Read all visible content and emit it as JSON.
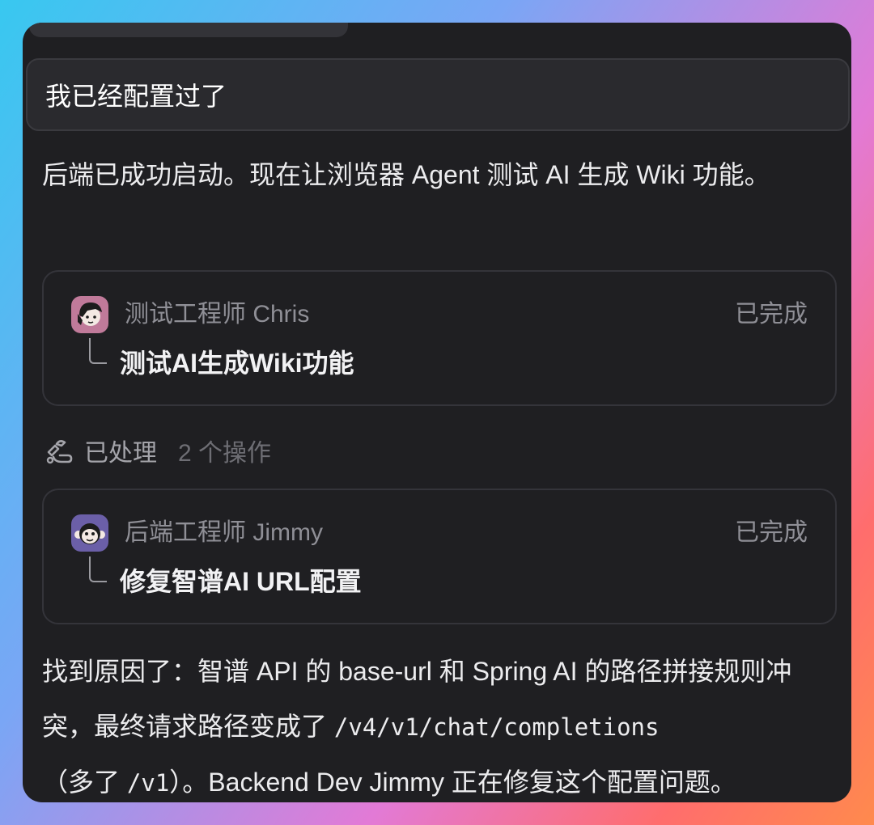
{
  "user_message": "我已经配置过了",
  "assistant_intro": "后端已成功启动。现在让浏览器 Agent 测试 AI 生成 Wiki 功能。",
  "tasks": [
    {
      "agent": "测试工程师 Chris",
      "status": "已完成",
      "task": "测试AI生成Wiki功能",
      "avatar_icon": "girl-avatar-icon",
      "avatar_color": "#c07a9a"
    },
    {
      "agent": "后端工程师 Jimmy",
      "status": "已完成",
      "task": "修复智谱AI URL配置",
      "avatar_icon": "monkey-avatar-icon",
      "avatar_color": "#6b5fa8"
    }
  ],
  "processed": {
    "label": "已处理",
    "count": "2 个操作",
    "icon": "tools-icon"
  },
  "conclusion": {
    "t1": "找到原因了：智谱 API 的 base-url 和 Spring AI 的路径拼接规则冲突，最终请求路径变成了 ",
    "code1": "/v4/v1/chat/completions",
    "t2": "（多了 ",
    "code2": "/v1",
    "t3": "）。Backend Dev Jimmy 正在修复这个配置问题。"
  }
}
